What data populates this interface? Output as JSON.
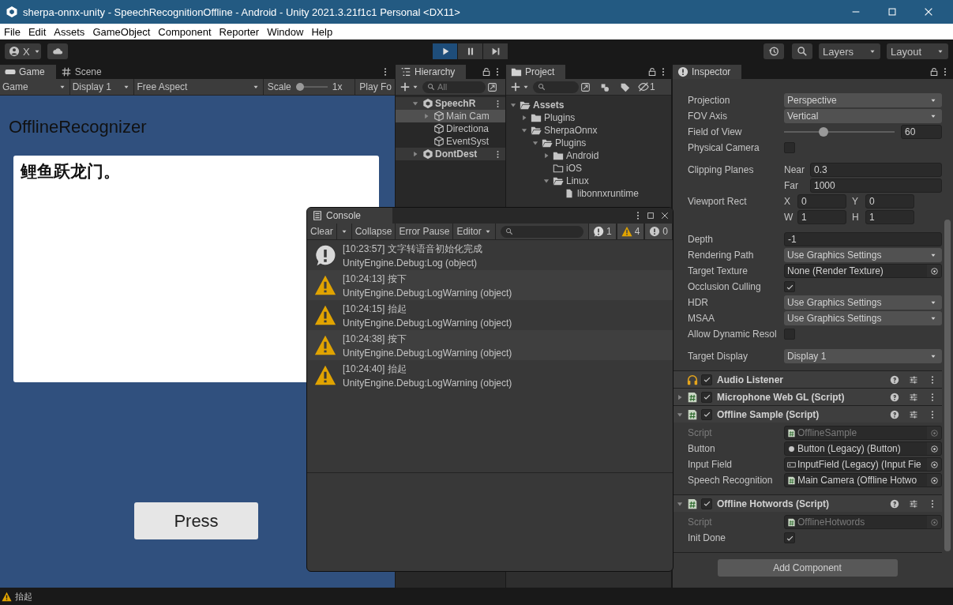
{
  "window": {
    "title": "sherpa-onnx-unity - SpeechRecognitionOffline - Android - Unity 2021.3.21f1c1 Personal <DX11>"
  },
  "menu": [
    "File",
    "Edit",
    "Assets",
    "GameObject",
    "Component",
    "Reporter",
    "Window",
    "Help"
  ],
  "toolbar": {
    "account": "X",
    "play_buttons": [
      {
        "kind": "play",
        "on": true
      },
      {
        "kind": "pause",
        "on": false
      },
      {
        "kind": "step",
        "on": false
      }
    ],
    "layers": "Layers",
    "layout": "Layout"
  },
  "game": {
    "tabs": [
      {
        "label": "Game",
        "kind": "game",
        "selected": true
      },
      {
        "label": "Scene",
        "kind": "scene",
        "selected": false
      }
    ],
    "toolbar": {
      "view": "Game",
      "display": "Display 1",
      "aspect": "Free Aspect",
      "scale_label": "Scale",
      "scale": {
        "level": 0
      },
      "scale_value": "1x",
      "play_focus": "Play Fo"
    },
    "title": "OfflineRecognizer",
    "text": "鲤鱼跃龙门。",
    "button": "Press"
  },
  "hierarchy": {
    "title": "Hierarchy",
    "search": {
      "placeholder": "All"
    },
    "items": [
      {
        "label": "SpeechR",
        "kind": "scene",
        "expanded": true,
        "selected": false,
        "children": [
          {
            "label": "Main Cam",
            "kind": "object",
            "expanded": false,
            "selected": true
          },
          {
            "label": "Directiona",
            "kind": "object",
            "selected": false
          },
          {
            "label": "EventSyst",
            "kind": "object",
            "selected": false
          }
        ]
      },
      {
        "label": "DontDest",
        "kind": "scene",
        "expanded": false,
        "selected": false
      }
    ]
  },
  "project": {
    "title": "Project",
    "hidden_count": "1",
    "items": [
      {
        "label": "Assets",
        "kind": "folder",
        "expanded": true,
        "children": [
          {
            "label": "Plugins",
            "kind": "folder",
            "expanded": false
          },
          {
            "label": "SherpaOnnx",
            "kind": "folder",
            "expanded": true,
            "children": [
              {
                "label": "Plugins",
                "kind": "folder",
                "expanded": true,
                "children": [
                  {
                    "label": "Android",
                    "kind": "folder",
                    "expanded": false
                  },
                  {
                    "label": "iOS",
                    "kind": "empty_folder"
                  },
                  {
                    "label": "Linux",
                    "kind": "folder",
                    "expanded": true,
                    "children": [
                      {
                        "label": "libonnxruntime",
                        "kind": "file"
                      }
                    ]
                  }
                ]
              }
            ]
          }
        ]
      }
    ]
  },
  "inspector": {
    "title": "Inspector",
    "properties": [
      {
        "kind": "dropdown",
        "label": "Projection",
        "value": "Perspective"
      },
      {
        "kind": "dropdown",
        "label": "FOV Axis",
        "value": "Vertical"
      },
      {
        "kind": "slider",
        "label": "Field of View",
        "level": 0.34,
        "value": "60"
      },
      {
        "kind": "checkbox",
        "label": "Physical Camera",
        "checked": false
      },
      {
        "kind": "field_rows",
        "label": "Clipping Planes",
        "rows": [
          [
            {
              "label": "Near",
              "value": "0.3"
            }
          ],
          [
            {
              "label": "Far",
              "value": "1000"
            }
          ]
        ]
      },
      {
        "kind": "field_rows",
        "label": "Viewport Rect",
        "rows": [
          [
            {
              "label": "X",
              "value": "0"
            },
            {
              "label": "Y",
              "value": "0"
            }
          ],
          [
            {
              "label": "W",
              "value": "1"
            },
            {
              "label": "H",
              "value": "1"
            }
          ]
        ]
      },
      {
        "kind": "field",
        "label": "Depth",
        "value": "-1"
      },
      {
        "kind": "dropdown",
        "label": "Rendering Path",
        "value": "Use Graphics Settings"
      },
      {
        "kind": "object",
        "label": "Target Texture",
        "value": "None (Render Texture)",
        "disabled": false
      },
      {
        "kind": "checkbox",
        "label": "Occlusion Culling",
        "checked": true
      },
      {
        "kind": "dropdown",
        "label": "HDR",
        "value": "Use Graphics Settings"
      },
      {
        "kind": "dropdown",
        "label": "MSAA",
        "value": "Use Graphics Settings"
      },
      {
        "kind": "checkbox",
        "label": "Allow Dynamic Resol",
        "checked": false
      },
      {
        "kind": "dropdown",
        "label": "Target Display",
        "value": "Display 1"
      }
    ],
    "components": [
      {
        "name": "Audio Listener",
        "kind": "audio",
        "enabled": true
      },
      {
        "name": "Microphone Web GL (Script)",
        "kind": "script",
        "enabled": true,
        "expanded": false
      },
      {
        "name": "Offline Sample (Script)",
        "kind": "script",
        "enabled": true,
        "expanded": true,
        "properties": [
          {
            "kind": "script_ref",
            "label": "Script",
            "value": "OfflineSample",
            "disabled": true
          },
          {
            "kind": "button_ref",
            "label": "Button",
            "value": "Button (Legacy) (Button)",
            "disabled": false
          },
          {
            "kind": "input_ref",
            "label": "Input Field",
            "value": "InputField (Legacy) (Input Fie",
            "disabled": false
          },
          {
            "kind": "script_ref",
            "label": "Speech Recognition",
            "value": "Main Camera (Offline Hotwo",
            "disabled": false
          }
        ]
      },
      {
        "name": "Offline Hotwords (Script)",
        "kind": "script",
        "enabled": true,
        "expanded": true,
        "properties": [
          {
            "kind": "script_ref",
            "label": "Script",
            "value": "OfflineHotwords",
            "disabled": true
          },
          {
            "kind": "checkbox",
            "label": "Init Done",
            "checked": true
          }
        ]
      }
    ],
    "add_button": "Add Component"
  },
  "console": {
    "title": "Console",
    "clear": "Clear",
    "toggles": [
      "Collapse",
      "Error Pause"
    ],
    "editor": "Editor",
    "counts": [
      {
        "kind": "log",
        "count": "1"
      },
      {
        "kind": "warning",
        "count": "4"
      },
      {
        "kind": "error",
        "count": "0"
      }
    ],
    "entries": [
      {
        "kind": "log",
        "message": "[10:23:57] 文字转语音初始化完成",
        "source": "UnityEngine.Debug:Log (object)"
      },
      {
        "kind": "warning",
        "message": "[10:24:13] 按下",
        "source": "UnityEngine.Debug:LogWarning (object)"
      },
      {
        "kind": "warning",
        "message": "[10:24:15] 抬起",
        "source": "UnityEngine.Debug:LogWarning (object)"
      },
      {
        "kind": "warning",
        "message": "[10:24:38] 按下",
        "source": "UnityEngine.Debug:LogWarning (object)"
      },
      {
        "kind": "warning",
        "message": "[10:24:40] 抬起",
        "source": "UnityEngine.Debug:LogWarning (object)"
      }
    ]
  },
  "status_bar": {
    "kind": "warning",
    "message": "抬起"
  }
}
